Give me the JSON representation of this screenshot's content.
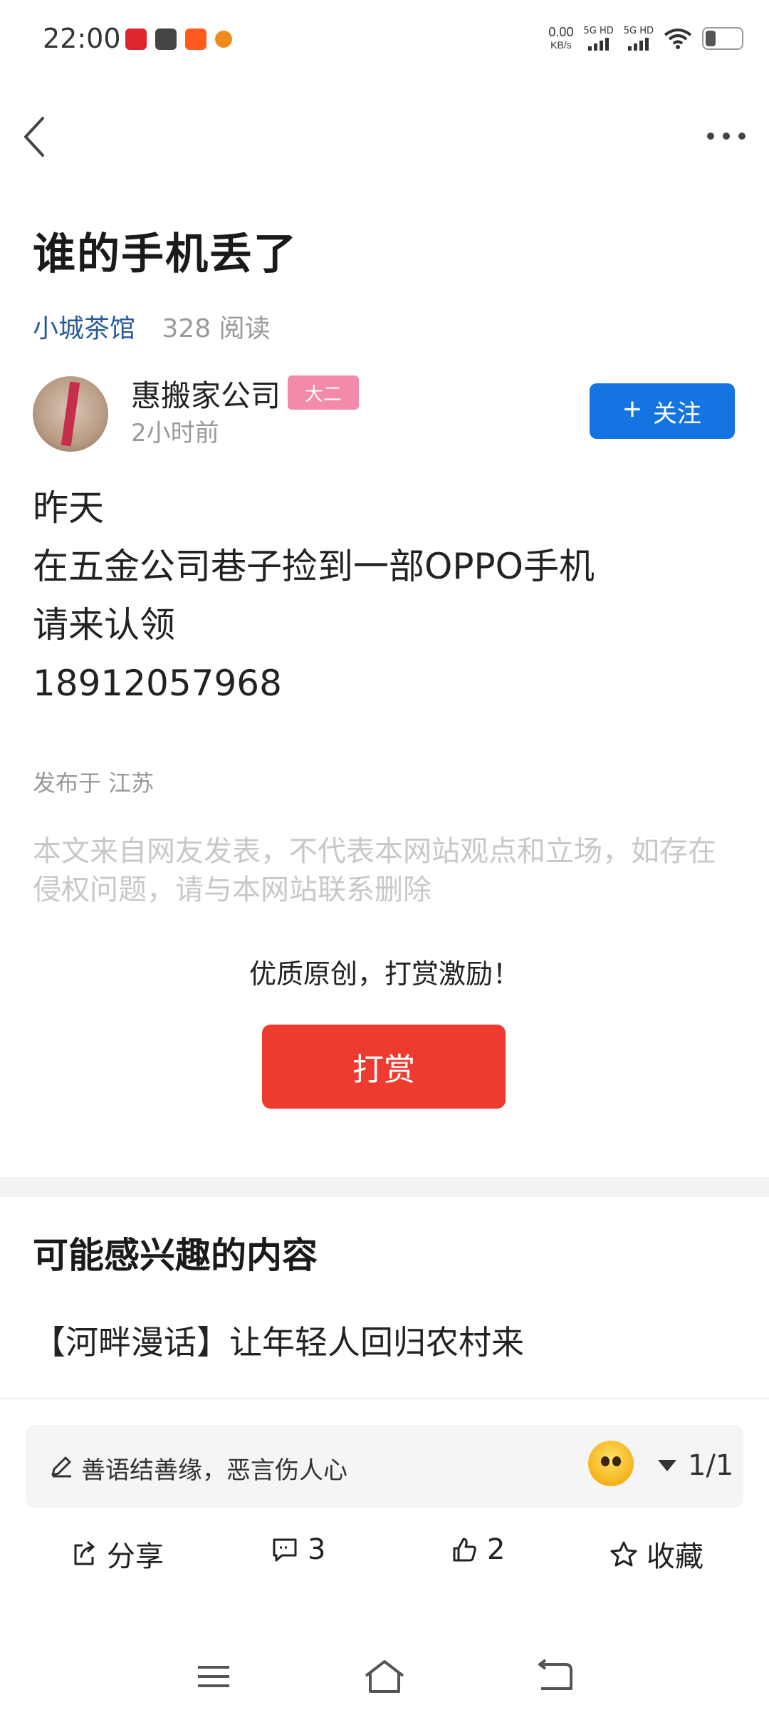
{
  "status_bar": {
    "time": "22:00",
    "net_speed_value": "0.00",
    "net_speed_unit": "KB/s",
    "signal_1_label": "5G HD",
    "signal_2_label": "5G HD"
  },
  "article": {
    "title": "谁的手机丢了",
    "forum": "小城茶馆",
    "reads": "328 阅读",
    "author": "惠搬家公司",
    "author_badge": "大二",
    "post_time": "2小时前",
    "follow_label": "关注",
    "body_lines": [
      "昨天",
      "在五金公司巷子捡到一部OPPO手机",
      "请来认领",
      "18912057968"
    ],
    "location": "发布于 江苏",
    "disclaimer": "本文来自网友发表，不代表本网站观点和立场，如存在侵权问题，请与本网站联系删除",
    "reward_hint": "优质原创，打赏激励！",
    "reward_button": "打赏"
  },
  "recommend": {
    "section_title": "可能感兴趣的内容",
    "items": [
      "【河畔漫话】让年轻人回归农村来"
    ]
  },
  "comment_bar": {
    "placeholder": "善语结善缘，恶言伤人心",
    "page": "1/1"
  },
  "actions": {
    "share": "分享",
    "comments": "3",
    "likes": "2",
    "collect": "收藏"
  },
  "colors": {
    "forum_link": "#2a5b99",
    "follow_button": "#1673e2",
    "reward_button": "#ee3b2f",
    "badge": "#f28aa9"
  },
  "icons": [
    "back-icon",
    "more-icon",
    "pen-icon",
    "emoji-icon",
    "share-icon",
    "comment-icon",
    "like-icon",
    "star-icon",
    "menu-icon",
    "home-icon",
    "return-icon"
  ]
}
